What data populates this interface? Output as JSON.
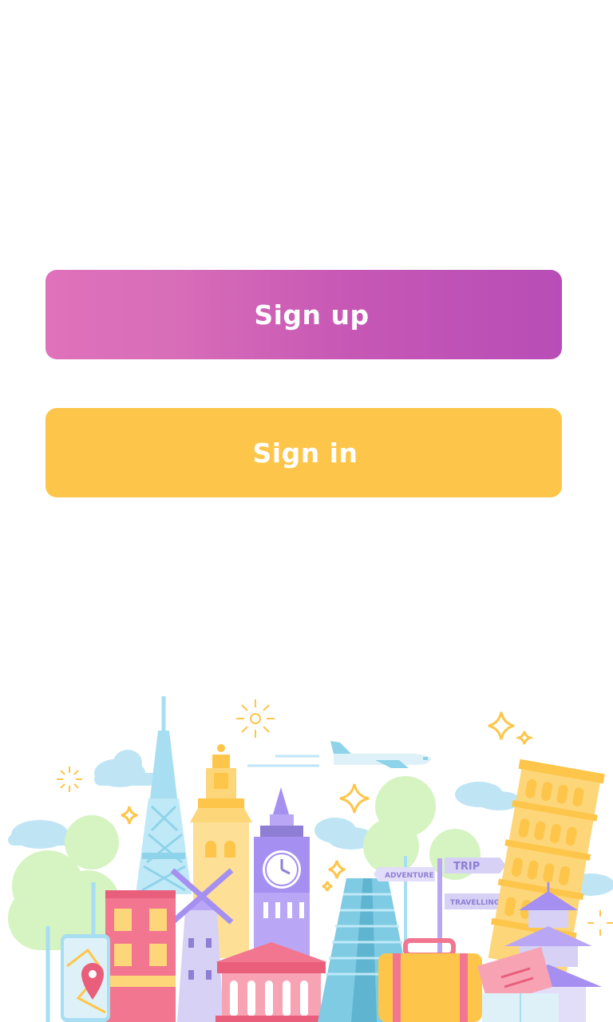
{
  "buttons": {
    "signup_label": "Sign up",
    "signin_label": "Sign in"
  },
  "illustration": {
    "signpost": {
      "trip": "TRIP",
      "adventure": "ADVENTURE",
      "travelling": "TRAVELLING"
    }
  },
  "colors": {
    "signup_gradient_start": "#e071bb",
    "signup_gradient_end": "#b84db7",
    "signin": "#fdc64a",
    "background": "#ffffff"
  }
}
